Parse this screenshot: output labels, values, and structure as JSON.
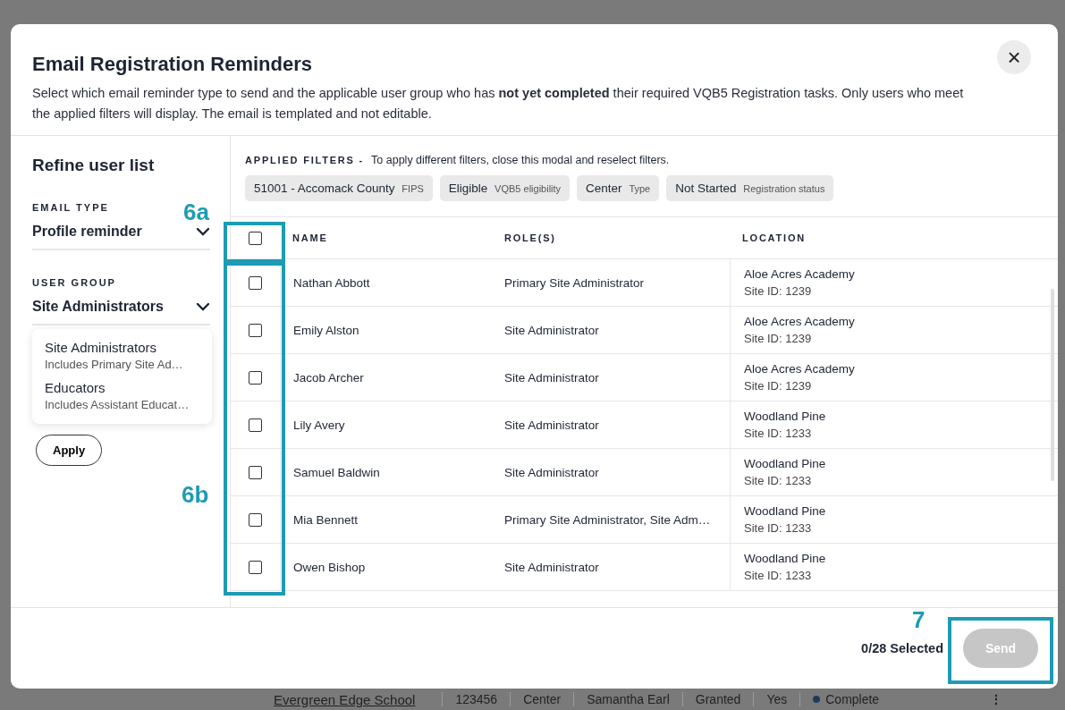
{
  "modal": {
    "title": "Email Registration Reminders",
    "description": "Select which email reminder type to send and the applicable user group who has **not yet completed** their required VQB5 Registration tasks. Only users who meet the applied filters will display. The email is templated and not editable.",
    "close_label": "×"
  },
  "sidebar": {
    "heading": "Refine user list",
    "email_type": {
      "label": "EMAIL TYPE",
      "value": "Profile reminder"
    },
    "user_group": {
      "label": "USER GROUP",
      "value": "Site Administrators",
      "options": [
        {
          "title": "Site Administrators",
          "subtitle": "Includes Primary Site Ad…"
        },
        {
          "title": "Educators",
          "subtitle": "Includes Assistant Educat…"
        }
      ]
    },
    "apply_button": "Apply"
  },
  "applied_filters": {
    "label": "APPLIED FILTERS -",
    "hint": "To apply different filters, close this modal and reselect filters.",
    "chips": [
      {
        "value": "51001 - Accomack County",
        "type": "FIPS"
      },
      {
        "value": "Eligible",
        "type": "VQB5 eligibility"
      },
      {
        "value": "Center",
        "type": "Type"
      },
      {
        "value": "Not Started",
        "type": "Registration status"
      }
    ]
  },
  "table": {
    "select_all_checked": false,
    "columns": [
      "NAME",
      "ROLE(S)",
      "LOCATION"
    ],
    "rows": [
      {
        "checked": false,
        "name": "Nathan Abbott",
        "role": "Primary Site Administrator",
        "location": "Aloe Acres Academy",
        "site_id": "Site ID: 1239"
      },
      {
        "checked": false,
        "name": "Emily Alston",
        "role": "Site Administrator",
        "location": "Aloe Acres Academy",
        "site_id": "Site ID: 1239"
      },
      {
        "checked": false,
        "name": "Jacob Archer",
        "role": "Site Administrator",
        "location": "Aloe Acres Academy",
        "site_id": "Site ID: 1239"
      },
      {
        "checked": false,
        "name": "Lily Avery",
        "role": "Site Administrator",
        "location": "Woodland Pine",
        "site_id": "Site ID: 1233"
      },
      {
        "checked": false,
        "name": "Samuel Baldwin",
        "role": "Site Administrator",
        "location": "Woodland Pine",
        "site_id": "Site ID: 1233"
      },
      {
        "checked": false,
        "name": "Mia Bennett",
        "role": "Primary Site Administrator, Site Adm…",
        "location": "Woodland Pine",
        "site_id": "Site ID: 1233"
      },
      {
        "checked": false,
        "name": "Owen Bishop",
        "role": "Site Administrator",
        "location": "Woodland Pine",
        "site_id": "Site ID: 1233"
      }
    ]
  },
  "footer": {
    "selected_count": "0/28 Selected",
    "send_button": "Send",
    "send_disabled": true
  },
  "background_row": {
    "school": "Evergreen Edge School",
    "cells": [
      "123456",
      "Center",
      "Samantha Earl",
      "Granted",
      "Yes"
    ],
    "status": "Complete",
    "menu": "⋮"
  },
  "callouts": [
    {
      "label": "6a"
    },
    {
      "label": "6b"
    },
    {
      "label": "7"
    }
  ]
}
